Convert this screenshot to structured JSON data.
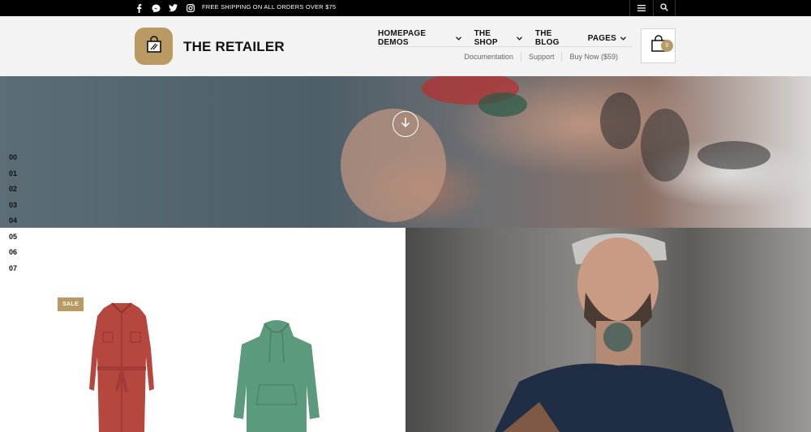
{
  "topbar": {
    "shipping_text": "FREE SHIPPING ON ALL ORDERS OVER $75",
    "social_icons": [
      "facebook-icon",
      "messenger-icon",
      "twitter-icon",
      "instagram-icon"
    ]
  },
  "header": {
    "brand": "THE RETAILER",
    "nav": [
      {
        "label": "HOMEPAGE DEMOS",
        "has_dropdown": true
      },
      {
        "label": "THE SHOP",
        "has_dropdown": true
      },
      {
        "label": "THE BLOG",
        "has_dropdown": false
      },
      {
        "label": "PAGES",
        "has_dropdown": true
      }
    ],
    "subnav": [
      "Documentation",
      "Support",
      "Buy Now ($59)"
    ],
    "cart_count": "0"
  },
  "slider": {
    "numbers": [
      "00",
      "01",
      "02",
      "03",
      "04",
      "05",
      "06",
      "07"
    ]
  },
  "products": {
    "sale_badge": "SALE"
  },
  "colors": {
    "accent": "#b99a62",
    "topbar_bg": "#000000",
    "header_bg": "#f3f3f3"
  }
}
